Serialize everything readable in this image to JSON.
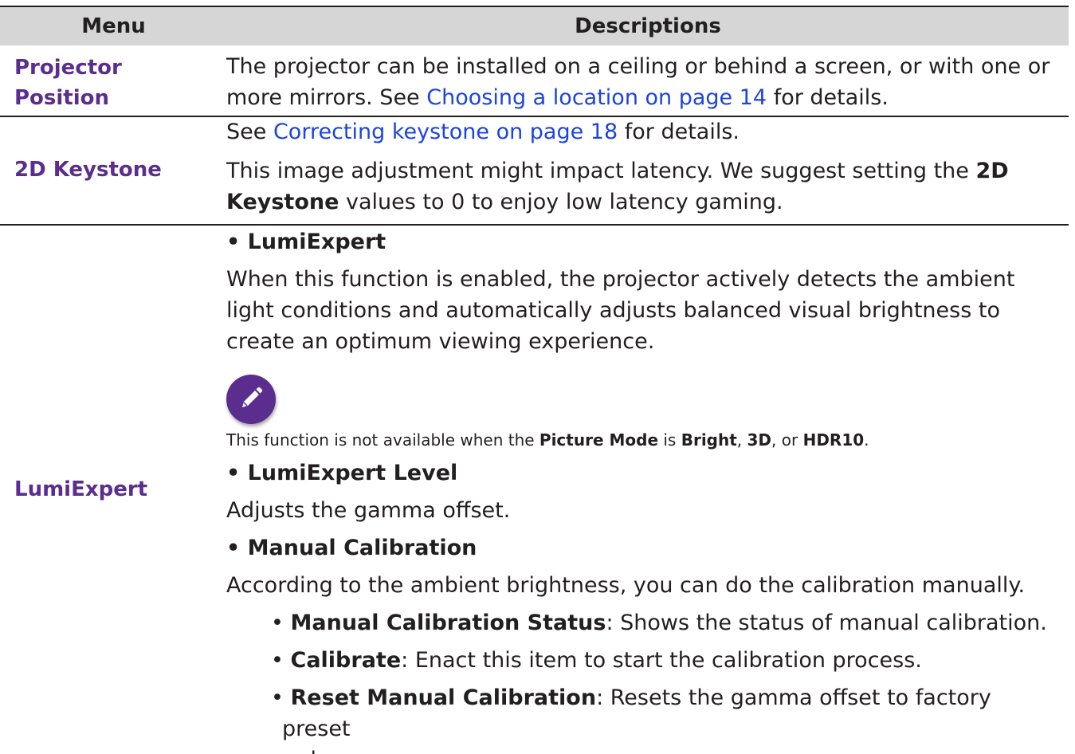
{
  "header": {
    "menu_label": "Menu",
    "desc_label": "Descriptions"
  },
  "rows": {
    "projector_position": {
      "menu": [
        "Projector",
        "Position"
      ],
      "line1": "The projector can be installed on a ceiling or behind a screen, or with one or",
      "line2_pre": "more mirrors. See ",
      "line2_link": "Choosing a location on page 14",
      "line2_post": " for details."
    },
    "keystone": {
      "menu": "2D Keystone",
      "p1_pre": "See ",
      "p1_link": "Correcting keystone on page 18",
      "p1_post": " for details.",
      "p2_line1_pre": "This image adjustment might impact latency. We suggest setting the ",
      "p2_line1_bold": "2D",
      "p2_line2_bold": "Keystone",
      "p2_line2_post": " values to 0 to enjoy low latency gaming."
    },
    "lumiexpert": {
      "menu": "LumiExpert",
      "bullet1": "• LumiExpert",
      "bullet1_lines": [
        "When this function is enabled, the projector actively detects the ambient",
        "light conditions and automatically adjusts balanced visual brightness to",
        "create an optimum viewing experience."
      ],
      "note": {
        "icon": "pencil-note-icon",
        "pre": "This function is not available when the ",
        "bold1": "Picture Mode",
        "mid1": " is ",
        "bold2": "Bright",
        "mid2": ", ",
        "bold3": "3D",
        "mid3": ", or ",
        "bold4": "HDR10",
        "post": "."
      },
      "bullet2": "• LumiExpert Level",
      "bullet2_text": "Adjusts the gamma offset.",
      "bullet3": "• Manual Calibration",
      "bullet3_text": "According to the ambient brightness, you can do the calibration manually.",
      "sub_items": [
        {
          "bullet": "• ",
          "bold": "Manual Calibration Status",
          "text": ": Shows the status of manual calibration."
        },
        {
          "bullet": "• ",
          "bold": "Calibrate",
          "text": ": Enact this item to start the calibration process."
        },
        {
          "bullet": "• ",
          "bold": "Reset Manual Calibration",
          "text": ": Resets the gamma offset to factory preset"
        }
      ],
      "sub_item_continuation": "values."
    }
  },
  "colors": {
    "menu_purple": "#5b2d8e",
    "link_blue": "#1c44e0",
    "header_gray": "#d6d6d6",
    "text": "#231f20"
  }
}
